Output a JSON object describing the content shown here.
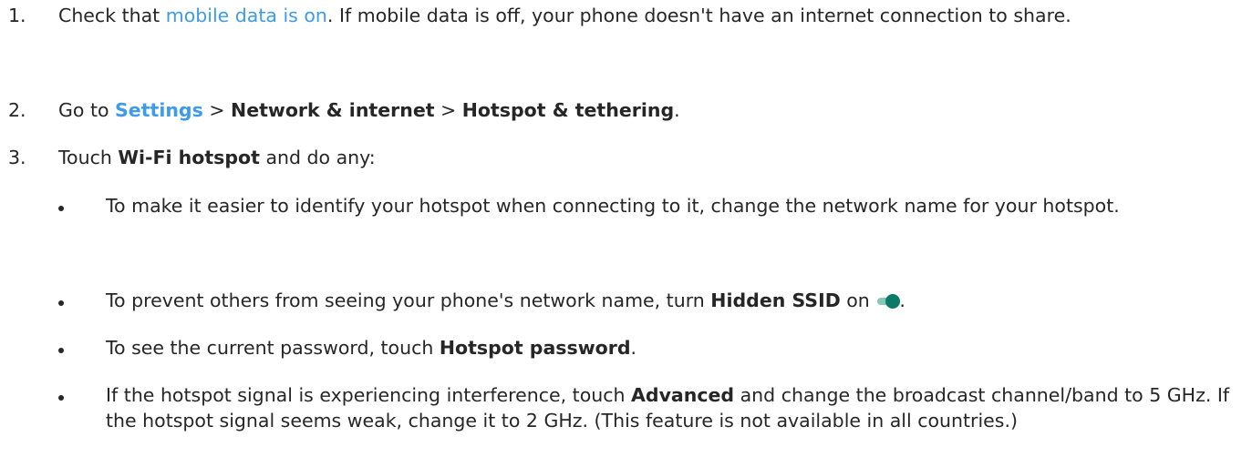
{
  "steps": [
    {
      "number": "1.",
      "prefix": "Check that ",
      "link": "mobile data is on",
      "suffix": ". If mobile data is off, your phone doesn't have an internet connection to share."
    },
    {
      "number": "2.",
      "prefix": "Go to ",
      "settings": "Settings",
      "sep1": " > ",
      "network": "Network & internet",
      "sep2": " > ",
      "hotspot": "Hotspot & tethering",
      "end": "."
    },
    {
      "number": "3.",
      "prefix": "Touch ",
      "wifi": "Wi-Fi hotspot",
      "suffix": " and do any:"
    }
  ],
  "bullets": [
    {
      "text": "To make it easier to identify your hotspot when connecting to it, change the network name for your hotspot."
    },
    {
      "prefix": "To prevent others from seeing your phone's network name, turn ",
      "bold": "Hidden SSID",
      "suffix": " on",
      "end": "."
    },
    {
      "prefix": "To see the current password, touch ",
      "bold": "Hotspot password",
      "end": "."
    },
    {
      "prefix": "If the hotspot signal is experiencing interference, touch ",
      "bold": "Advanced",
      "suffix": " and change the broadcast channel/band to 5 GHz. If the hotspot signal seems weak, change it to 2 GHz. (This feature is not available in all countries.)"
    }
  ],
  "colors": {
    "text": "#262626",
    "link": "#3d9be9",
    "toggle_track": "#85c7b9",
    "toggle_thumb": "#0b7a66"
  },
  "icons": {
    "toggle": "toggle-on-icon"
  }
}
